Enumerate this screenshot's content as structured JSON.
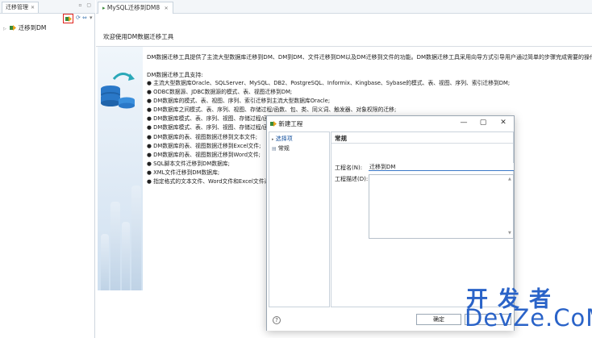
{
  "left_panel": {
    "tab_title": "迁移管理",
    "window_buttons": "▫ ▢",
    "tree_item": "迁移到DM"
  },
  "editor": {
    "tab_title": "MySQL迁移到DM8",
    "welcome_title": "欢迎使用DM数据迁移工具",
    "intro": "DM数据迁移工具提供了主流大型数据库迁移到DM、DM到DM、文件迁移到DM以及DM迁移到文件的功能。DM数据迁移工具采用向导方式引导用户通过简单的步骤完成需要的操作。",
    "support_title": "DM数据迁移工具支持:",
    "features": [
      "● 主流大型数据库Oracle、SQLServer、MySQL、DB2、PostgreSQL、Informix、Kingbase、Sybase的模式、表、视图、序列、索引迁移到DM;",
      "● ODBC数据源、JDBC数据源的模式、表、视图迁移到DM;",
      "● DM数据库的模式、表、视图、序列、索引迁移到主流大型数据库Oracle;",
      "● DM数据库之间模式、表、序列、视图、存储过程/函数、包、类、同义词、触发器、对象权限的迁移;",
      "● DM数据库模式、表、序列、视图、存储过程/函",
      "● DM数据库模式、表、序列、视图、存储过程/函",
      "● DM数据库的表、视图数据迁移到文本文件;",
      "● DM数据库的表、视图数据迁移到Excel文件;",
      "● DM数据库的表、视图数据迁移到Word文件;",
      "● SQL脚本文件迁移到DM数据库;",
      "● XML文件迁移到DM数据库;",
      "● 指定格式的文本文件、Word文件和Excel文件迁"
    ]
  },
  "dialog": {
    "title": "新建工程",
    "nav": [
      "选择项",
      "常规"
    ],
    "page_title": "常规",
    "name_label": "工程名(N):",
    "name_value": "迁移到DM",
    "desc_label": "工程描述(D):",
    "help_label": "?",
    "ok_label": "确定",
    "cancel_label": ""
  },
  "watermark": {
    "cn": "开发者",
    "en": "DevZe.CoM"
  },
  "colors": {
    "accent": "#3b78c8",
    "highlight_border": "#e0241f",
    "watermark": "#2a63c8"
  }
}
